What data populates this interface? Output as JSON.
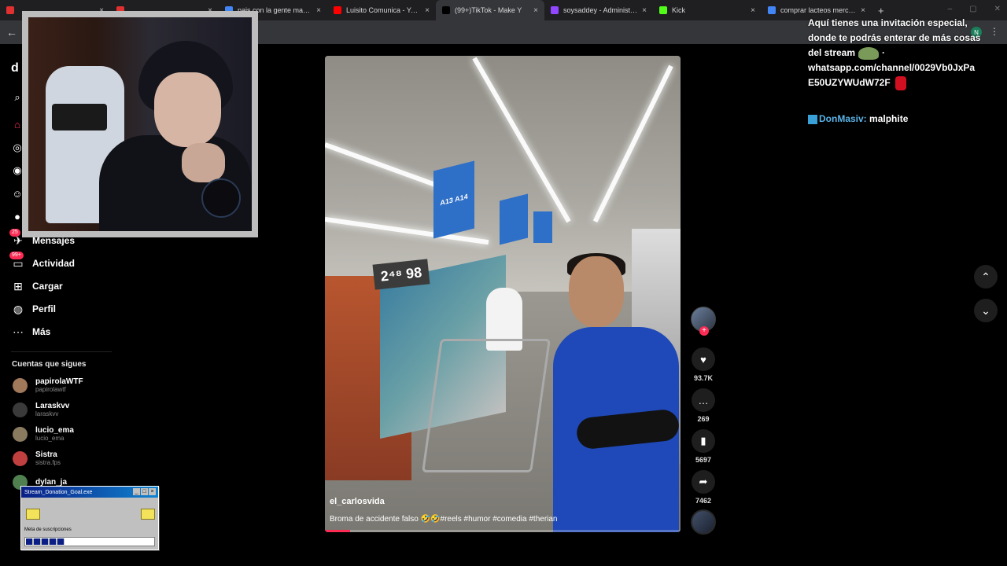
{
  "browser": {
    "tabs": [
      {
        "title": "",
        "favicon_color": "#e03030",
        "active": false
      },
      {
        "title": "",
        "favicon_color": "#e03030",
        "active": false
      },
      {
        "title": "pais con la gente mas alt",
        "favicon_color": "#4285f4",
        "active": false
      },
      {
        "title": "Luisito Comunica - YouTu",
        "favicon_color": "#ff0000",
        "active": false
      },
      {
        "title": "(99+)TikTok - Make Y",
        "favicon_color": "#000000",
        "active": true
      },
      {
        "title": "soysaddey - Administrad",
        "favicon_color": "#9146ff",
        "active": false
      },
      {
        "title": "Kick",
        "favicon_color": "#53fc18",
        "active": false
      },
      {
        "title": "comprar lacteos mercad",
        "favicon_color": "#4285f4",
        "active": false
      }
    ],
    "new_tab": "+",
    "profile_initial": "N"
  },
  "sidebar": {
    "logo": "d",
    "nav": [
      {
        "label": "Mensajes",
        "icon": "send-icon",
        "badge": "25"
      },
      {
        "label": "Actividad",
        "icon": "inbox-icon",
        "badge": "99+"
      },
      {
        "label": "Cargar",
        "icon": "upload-icon",
        "badge": ""
      },
      {
        "label": "Perfil",
        "icon": "profile-avatar-icon",
        "badge": ""
      },
      {
        "label": "Más",
        "icon": "more-icon",
        "badge": ""
      }
    ],
    "following_header": "Cuentas que sigues",
    "following": [
      {
        "name": "papirolaWTF",
        "handle": "papirolawtf",
        "color": "#a0785a"
      },
      {
        "name": "Laraskvv",
        "handle": "laraskvv",
        "color": "#3a3a3a"
      },
      {
        "name": "lucio_ema",
        "handle": "lucio_ema",
        "color": "#8a7a60"
      },
      {
        "name": "Sistra",
        "handle": "sistra.fps",
        "color": "#c04040"
      },
      {
        "name": "dylan_ja",
        "handle": "",
        "color": "#508050"
      }
    ]
  },
  "video": {
    "author": "el_carlosvida",
    "caption": "Broma de accidente falso 🤣🤣#reels #humor #comedia #therian",
    "price_sign": "2⁴⁸ 98",
    "aisle_sign": "A13 A14",
    "progress": 0.07
  },
  "actions": {
    "likes": "93.7K",
    "comments": "269",
    "saves": "5697",
    "shares": "7462"
  },
  "chat": {
    "message1": "Aquí tienes una invitación especial, donde te podrás enterar de más cosas del stream",
    "message1_link": "whatsapp.com/channel/0029Vb0JxPa E50UZYWUdW72F",
    "user2": "DonMasiv:",
    "message2": "malphite"
  },
  "donation": {
    "window_title": "Stream_Donation_Goal.exe",
    "goal_label": "Meta de suscripciones",
    "progress": 0.3
  },
  "colors": {
    "tiktok_red": "#fe2c55",
    "background": "#000000"
  }
}
